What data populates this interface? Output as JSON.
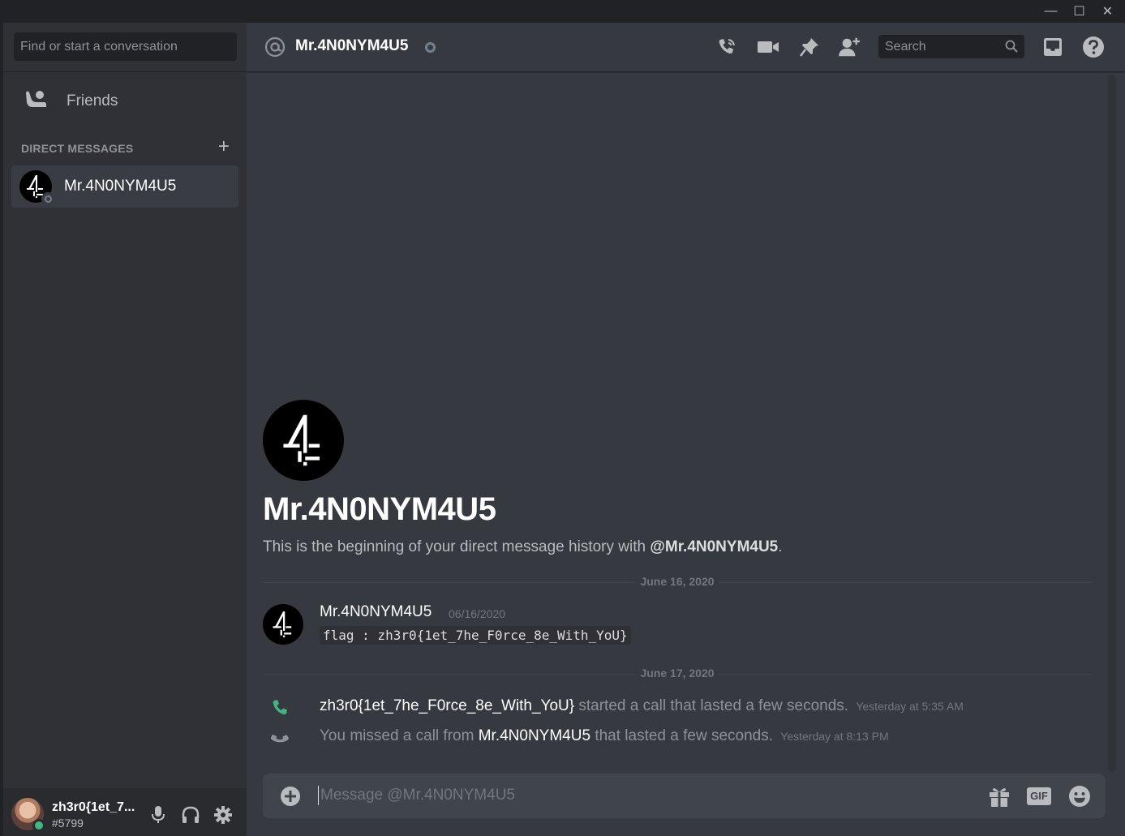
{
  "window": {
    "minimize_glyph": "—",
    "maximize_glyph": "☐",
    "close_glyph": "✕"
  },
  "sidebar": {
    "search_placeholder": "Find or start a conversation",
    "friends_label": "Friends",
    "dm_header": "DIRECT MESSAGES",
    "dm_add_glyph": "+",
    "dm_items": [
      {
        "name": "Mr.4N0NYM4U5",
        "status": "offline",
        "avatar_icon": "channel4-logo-icon"
      }
    ]
  },
  "user_panel": {
    "username": "zh3r0{1et_7...",
    "discriminator": "#5799",
    "status": "online",
    "status_color": "#43b581"
  },
  "topbar": {
    "channel_name": "Mr.4N0NYM4U5",
    "search_placeholder": "Search",
    "icons": [
      "start-voice-call-icon",
      "start-video-call-icon",
      "pinned-messages-icon",
      "add-friend-to-dm-icon",
      "inbox-icon",
      "help-icon"
    ]
  },
  "intro": {
    "name": "Mr.4N0NYM4U5",
    "text_before": "This is the beginning of your direct message history with ",
    "mention": "@Mr.4N0NYM4U5",
    "text_after": "."
  },
  "messages": {
    "divider_1": "June 16, 2020",
    "message_1": {
      "author": "Mr.4N0NYM4U5",
      "timestamp": "06/16/2020",
      "content": "flag : zh3r0{1et_7he_F0rce_8e_With_YoU}"
    },
    "divider_2": "June 17, 2020",
    "system_1": {
      "actor": "zh3r0{1et_7he_F0rce_8e_With_YoU}",
      "text": " started a call that lasted a few seconds.",
      "timestamp": "Yesterday at 5:35 AM",
      "icon_color": "#43b581"
    },
    "system_2": {
      "prefix": "You missed a call from ",
      "actor": "Mr.4N0NYM4U5",
      "text": " that lasted a few seconds.",
      "timestamp": "Yesterday at 8:13 PM",
      "icon_color": "#8e9297"
    }
  },
  "composer": {
    "placeholder": "Message @Mr.4N0NYM4U5",
    "gif_label": "GIF",
    "icons": [
      "upload-add-icon",
      "gift-icon",
      "gif-icon",
      "emoji-icon"
    ]
  },
  "colors": {
    "background_main": "#36393f",
    "background_sidebar": "#2f3136",
    "background_frame": "#202225",
    "text_primary": "#dcddde",
    "text_muted": "#72767d"
  }
}
